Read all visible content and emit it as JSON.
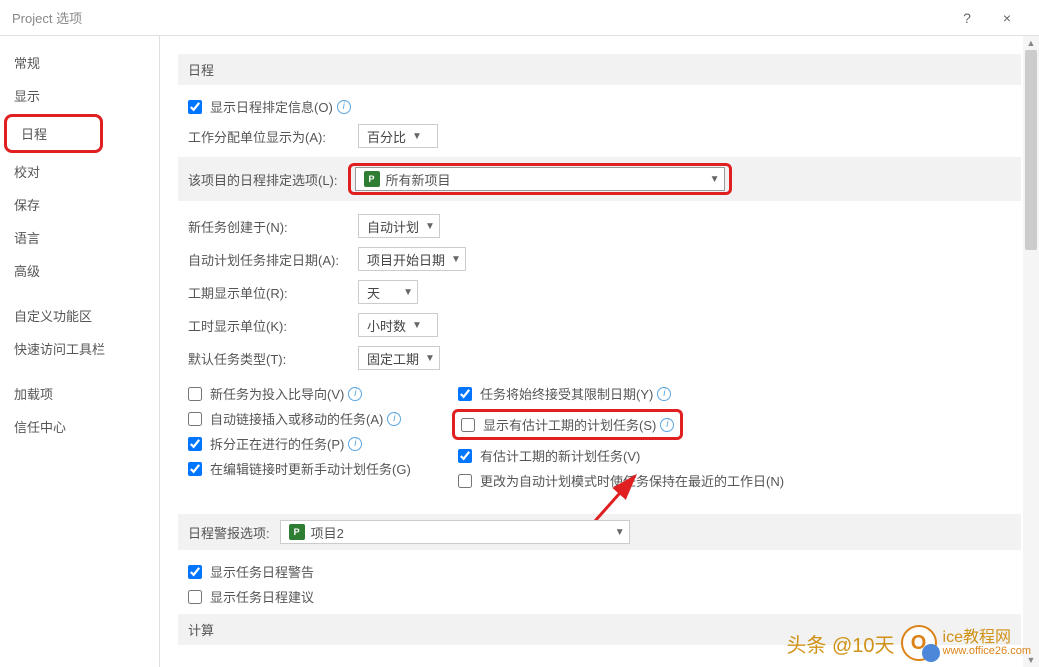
{
  "titlebar": {
    "title": "Project 选项",
    "help": "?",
    "close": "×"
  },
  "sidebar": {
    "items": [
      {
        "label": "常规"
      },
      {
        "label": "显示"
      },
      {
        "label": "日程"
      },
      {
        "label": "校对"
      },
      {
        "label": "保存"
      },
      {
        "label": "语言"
      },
      {
        "label": "高级"
      },
      {
        "label": "自定义功能区"
      },
      {
        "label": "快速访问工具栏"
      },
      {
        "label": "加载项"
      },
      {
        "label": "信任中心"
      }
    ]
  },
  "sections": {
    "schedule": "日程",
    "schedule_alert": "日程警报选项:",
    "calc": "计算"
  },
  "fields": {
    "show_schedule_info": "显示日程排定信息(O)",
    "work_unit_label": "工作分配单位显示为(A):",
    "work_unit_value": "百分比",
    "project_schedule_label": "该项目的日程排定选项(L):",
    "project_schedule_value": "所有新项目",
    "new_task_label": "新任务创建于(N):",
    "new_task_value": "自动计划",
    "auto_plan_label": "自动计划任务排定日期(A):",
    "auto_plan_value": "项目开始日期",
    "duration_unit_label": "工期显示单位(R):",
    "duration_unit_value": "天",
    "work_time_unit_label": "工时显示单位(K):",
    "work_time_unit_value": "小时数",
    "default_task_type_label": "默认任务类型(T):",
    "default_task_type_value": "固定工期",
    "chk_new_task_effort": "新任务为投入比导向(V)",
    "chk_auto_link": "自动链接插入或移动的任务(A)",
    "chk_split": "拆分正在进行的任务(P)",
    "chk_edit_link": "在编辑链接时更新手动计划任务(G)",
    "chk_task_accept_limit": "任务将始终接受其限制日期(Y)",
    "chk_show_est_duration": "显示有估计工期的计划任务(S)",
    "chk_est_duration_new": "有估计工期的新计划任务(V)",
    "chk_keep_nearest": "更改为自动计划模式时使任务保持在最近的工作日(N)",
    "alert_project_value": "项目2",
    "chk_show_schedule_alert": "显示任务日程警告",
    "chk_show_schedule_suggest": "显示任务日程建议"
  },
  "watermark": {
    "text1": "头条 @10天",
    "text2": "ice教程网",
    "url": "www.office26.com"
  },
  "icons": {
    "proj": "P"
  }
}
